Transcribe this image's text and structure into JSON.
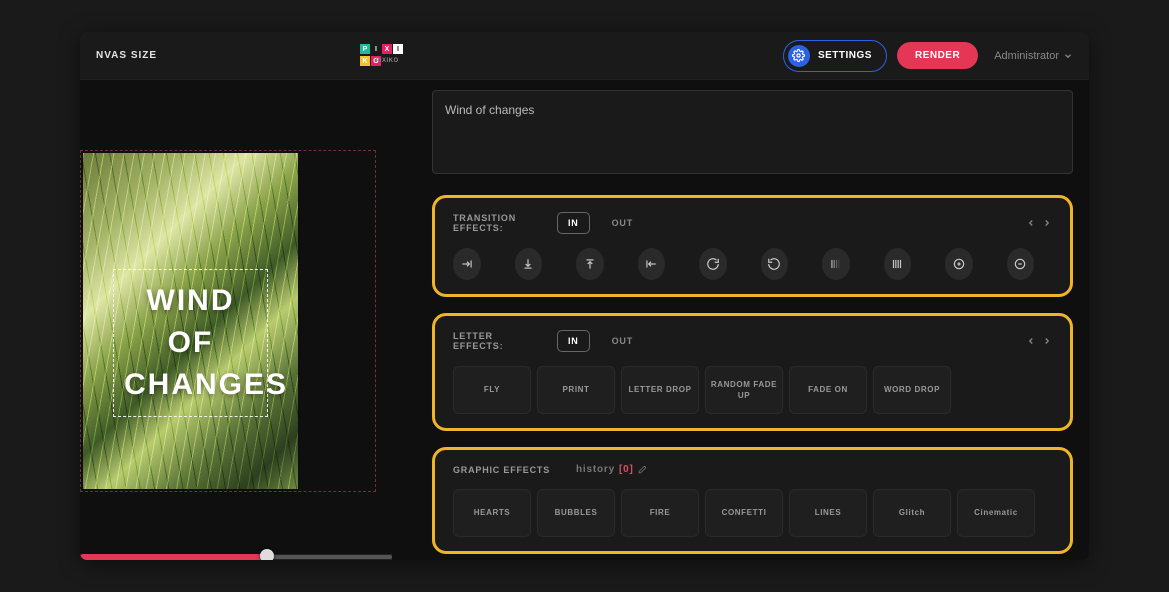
{
  "header": {
    "canvas_size_label": "NVAS SIZE",
    "settings_label": "SETTINGS",
    "render_label": "RENDER",
    "user_name": "Administrator"
  },
  "canvas": {
    "overlay_text": "WIND OF CHANGES",
    "textarea_value": "Wind of changes"
  },
  "panel_transition": {
    "label": "TRANSITION EFFECTS:",
    "in_label": "IN",
    "out_label": "OUT"
  },
  "panel_letter": {
    "label": "LETTER EFFECTS:",
    "in_label": "IN",
    "out_label": "OUT",
    "effects": [
      "FLY",
      "PRINT",
      "LETTER DROP",
      "RANDOM FADE UP",
      "FADE ON",
      "WORD DROP"
    ]
  },
  "panel_graphic": {
    "label": "GRAPHIC EFFECTS",
    "history_label": "history",
    "history_count": "[0]",
    "effects": [
      "HEARTS",
      "BUBBLES",
      "FIRE",
      "CONFETTI",
      "LINES",
      "Glitch",
      "Cinematic"
    ]
  }
}
